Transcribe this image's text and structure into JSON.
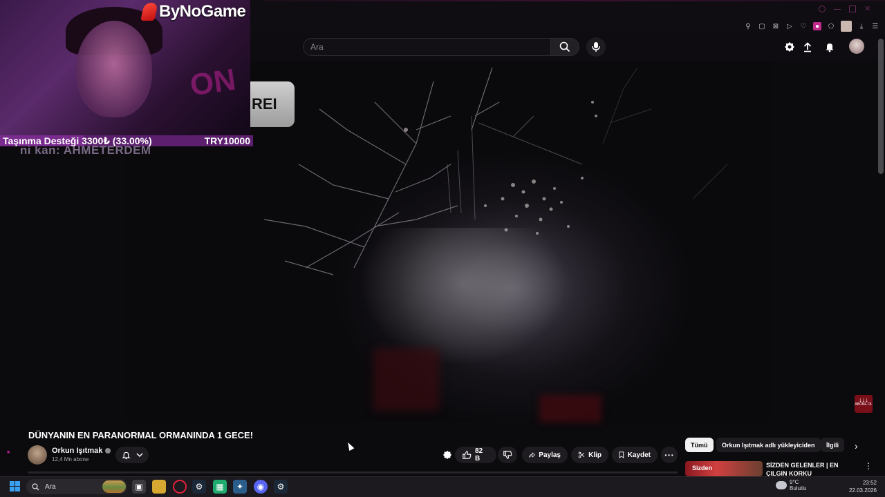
{
  "overlay": {
    "brand": "ByNoGame",
    "donation_left": "Taşınma Desteği 3300₺ (33.00%)",
    "donation_right": "TRY10000",
    "donation_progress": 0.33,
    "new_subscriber": "Yeni kan: AHMETERDEM",
    "game_hud_text": "REI",
    "cam_neon": "ON"
  },
  "search": {
    "placeholder": "Ara"
  },
  "video": {
    "title": "DÜNYANIN EN PARANORMAL ORMANINDA 1 GECE!",
    "badge_text": "ABONE OL"
  },
  "channel": {
    "name": "Orkun Işıtmak",
    "subscribers": "12,4 Mn abone"
  },
  "actions": {
    "likes": "82 B",
    "share": "Paylaş",
    "clip": "Klip",
    "save": "Kaydet"
  },
  "chips": [
    "Tümü",
    "Orkun Işıtmak adlı yükleyiciden",
    "İlgili"
  ],
  "recommendation": {
    "title": "SİZDEN GELENLER | EN ÇILGIN KORKU HİKAYELERİNİZ!",
    "thumb_text": "Sizden"
  },
  "taskbar": {
    "search_label": "Ara",
    "weather_temp": "9°C",
    "weather_desc": "Bulutlu",
    "time": "23:52",
    "date": "22.03.2026"
  },
  "colors": {
    "brand_red": "#e03030",
    "donation_purple": "#5b1f6e",
    "accent_pink": "#c02a8c",
    "windows_blue": "#3aa0f0"
  }
}
